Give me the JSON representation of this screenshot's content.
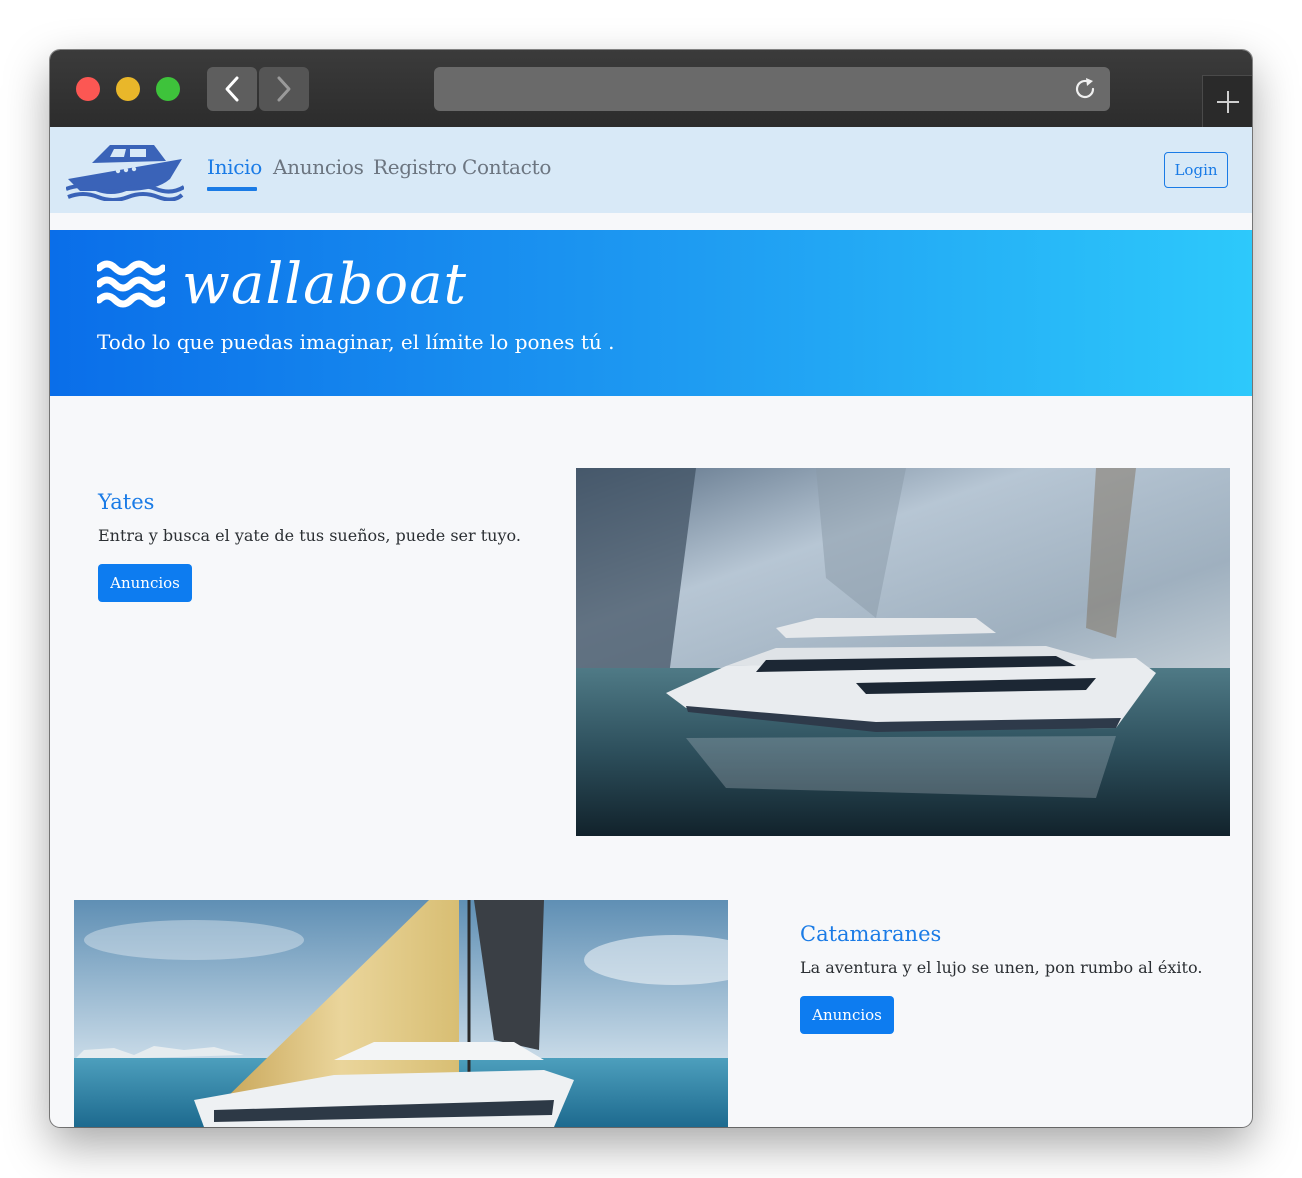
{
  "browser": {
    "url": ""
  },
  "nav": {
    "items": [
      {
        "label": "Inicio",
        "active": true
      },
      {
        "label": "Anuncios",
        "active": false
      },
      {
        "label": "Registro",
        "active": false
      },
      {
        "label": "Contacto",
        "active": false
      }
    ],
    "login_label": "Login"
  },
  "hero": {
    "brand": "wallaboat",
    "tagline": "Todo lo que puedas imaginar, el límite lo pones tú ."
  },
  "sections": [
    {
      "title": "Yates",
      "description": "Entra y busca el yate de tus sueños, puede ser tuyo.",
      "button_label": "Anuncios"
    },
    {
      "title": "Catamaranes",
      "description": "La aventura y el lujo se unen, pon rumbo al éxito.",
      "button_label": "Anuncios"
    }
  ],
  "colors": {
    "accent": "#1a7be6",
    "navbar_bg": "#d8e9f7",
    "hero_start": "#0a6ee9",
    "hero_end": "#2dc9fb",
    "button": "#0d7cf0"
  },
  "icons": {
    "logo": "boat-logo-icon",
    "back": "chevron-left-icon",
    "forward": "chevron-right-icon",
    "reload": "reload-icon",
    "new_tab": "plus-icon",
    "hero": "waves-icon"
  }
}
